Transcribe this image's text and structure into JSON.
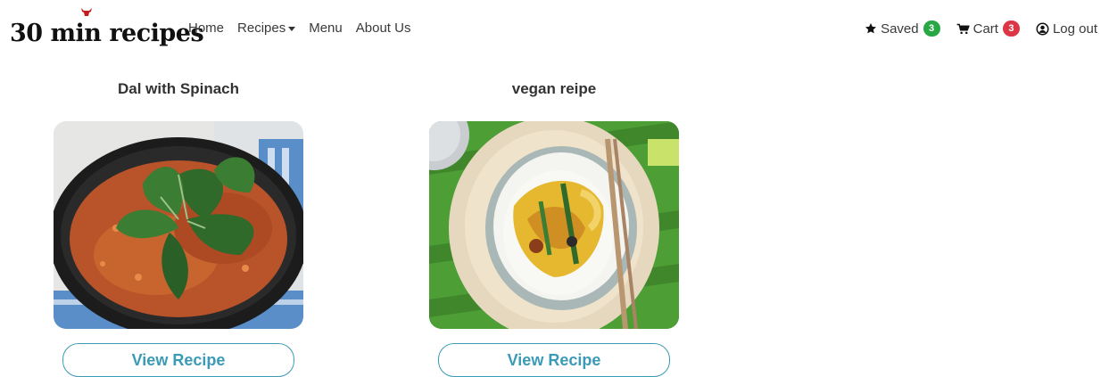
{
  "brand": {
    "name": "30 min recipes"
  },
  "nav": {
    "home": "Home",
    "recipes": "Recipes",
    "menu": "Menu",
    "about": "About Us"
  },
  "user_nav": {
    "saved_label": "Saved",
    "saved_count": "3",
    "cart_label": "Cart",
    "cart_count": "3",
    "logout_label": "Log out"
  },
  "colors": {
    "saved_badge": "#28a745",
    "cart_badge": "#dc3545",
    "accent": "#3b9bb7"
  },
  "recipes": [
    {
      "title": "Dal with Spinach",
      "button": "View Recipe"
    },
    {
      "title": "vegan reipe",
      "button": "View Recipe"
    }
  ]
}
